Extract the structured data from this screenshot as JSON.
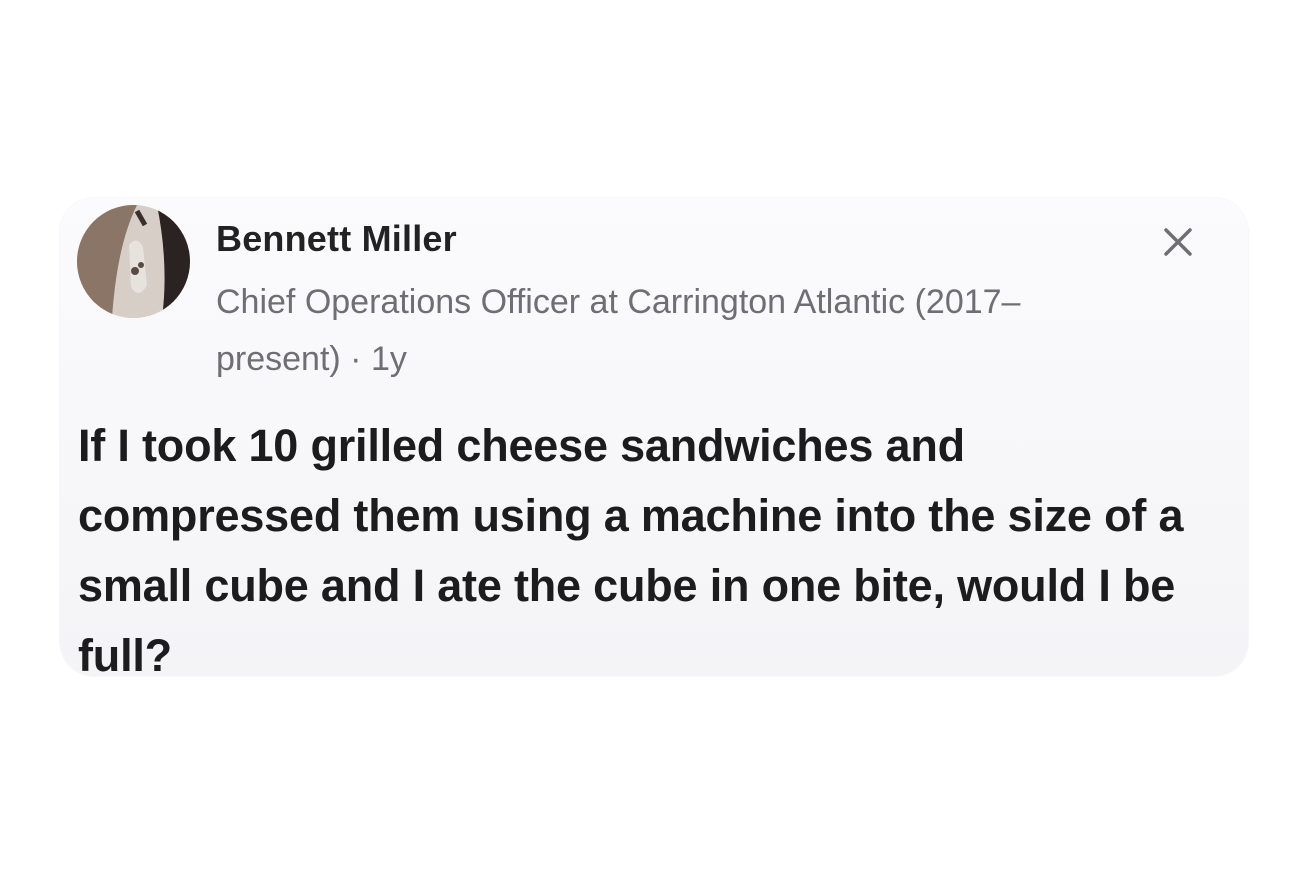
{
  "post": {
    "author": {
      "name": "Bennett Miller",
      "credential": "Chief Operations Officer at Carrington Atlantic (2017–present) · 1y",
      "avatar_icon": "profile-photo"
    },
    "close_icon": "close-icon",
    "question": "If I took 10 grilled cheese sandwiches and compressed them using a machine into the size of a small cube and I ate the cube in one bite, would I be full?"
  },
  "colors": {
    "card_background": "#f6f6f9",
    "name_text": "#222222",
    "subtitle_text": "#6e6e73",
    "question_text": "#1c1c1e"
  }
}
